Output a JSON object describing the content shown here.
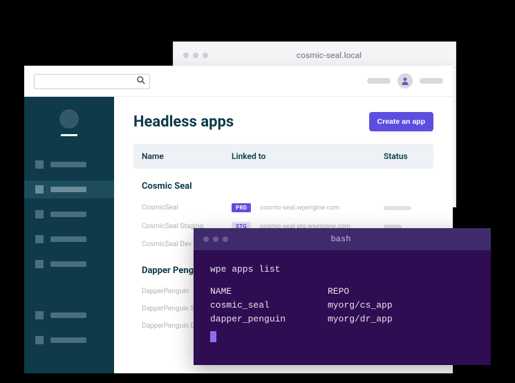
{
  "browser": {
    "url": "cosmic-seal.local"
  },
  "dashboard": {
    "header": {
      "title": "Headless apps",
      "create_button": "Create an app"
    },
    "columns": {
      "name": "Name",
      "linked": "Linked to",
      "status": "Status"
    },
    "groups": [
      {
        "title": "Cosmic Seal",
        "rows": [
          {
            "name": "CosmicSeal",
            "badge": "PRD",
            "badge_kind": "prd",
            "linked": "cosmic-seal.wpengine.com"
          },
          {
            "name": "CosmicSeal Staging",
            "badge": "STG",
            "badge_kind": "stg",
            "linked": "cosmic-seal-stg.wpengine.com"
          },
          {
            "name": "CosmicSeal Dev",
            "badge": "",
            "badge_kind": "",
            "linked": ""
          }
        ]
      },
      {
        "title": "Dapper Penguin",
        "rows": [
          {
            "name": "DapperPenguin",
            "badge": "",
            "badge_kind": "",
            "linked": ""
          },
          {
            "name": "DapperPenguin Staging",
            "badge": "",
            "badge_kind": "",
            "linked": ""
          },
          {
            "name": "DapperPenguin Dev",
            "badge": "",
            "badge_kind": "",
            "linked": ""
          }
        ]
      }
    ]
  },
  "terminal": {
    "title": "bash",
    "command": "wpe apps list",
    "header": {
      "name": "NAME",
      "repo": "REPO"
    },
    "rows": [
      {
        "name": "cosmic_seal",
        "repo": "myorg/cs_app"
      },
      {
        "name": "dapper_penguin",
        "repo": "myorg/dr_app"
      }
    ]
  }
}
